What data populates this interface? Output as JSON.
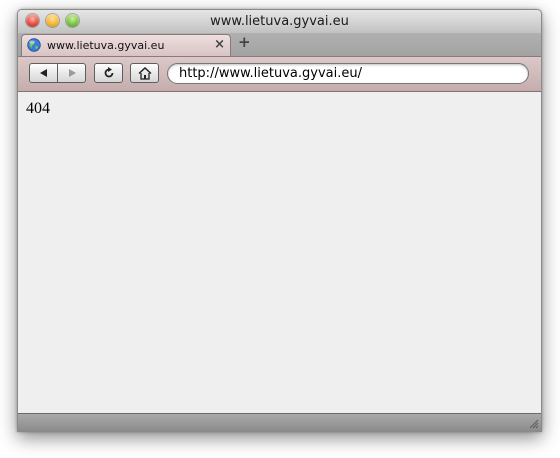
{
  "window": {
    "title": "www.lietuva.gyvai.eu"
  },
  "tabs": [
    {
      "label": "www.lietuva.gyvai.eu",
      "favicon": "globe-icon",
      "close_glyph": "×"
    }
  ],
  "new_tab_glyph": "+",
  "toolbar": {
    "back_icon": "back-arrow-icon",
    "forward_icon": "forward-arrow-icon",
    "reload_icon": "reload-icon",
    "home_icon": "home-icon",
    "url": "http://www.lietuva.gyvai.eu/"
  },
  "page": {
    "body_text": "404"
  },
  "colors": {
    "toolbar_tint": "#d2bcbc",
    "content_bg": "#efefef",
    "close": "#e0443a",
    "minimize": "#f3b12c",
    "maximize": "#6fbf3a"
  }
}
